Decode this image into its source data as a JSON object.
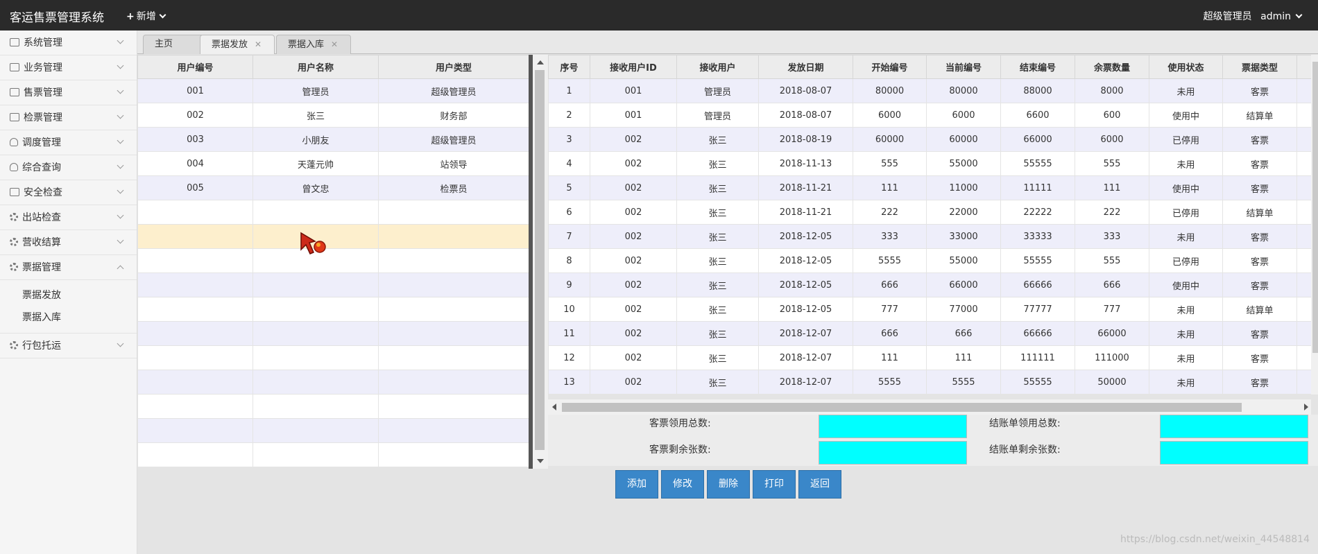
{
  "header": {
    "app_title": "客运售票管理系统",
    "new_menu": "新增",
    "user_role": "超级管理员",
    "user_name": "admin"
  },
  "sidebar": {
    "items": [
      {
        "label": "系统管理",
        "icon": "settings-icon"
      },
      {
        "label": "业务管理",
        "icon": "book-icon"
      },
      {
        "label": "售票管理",
        "icon": "calendar-icon"
      },
      {
        "label": "检票管理",
        "icon": "clipboard-icon"
      },
      {
        "label": "调度管理",
        "icon": "person-icon"
      },
      {
        "label": "综合查询",
        "icon": "user-icon"
      },
      {
        "label": "安全检查",
        "icon": "car-icon"
      },
      {
        "label": "出站检查",
        "icon": "gear-icon"
      },
      {
        "label": "营收结算",
        "icon": "gear-icon"
      },
      {
        "label": "票据管理",
        "icon": "gear-icon"
      },
      {
        "label": "行包托运",
        "icon": "gear-icon"
      }
    ],
    "subitems": [
      "票据发放",
      "票据入库"
    ]
  },
  "tabs": [
    {
      "label": "主页"
    },
    {
      "label": "票据发放"
    },
    {
      "label": "票据入库"
    }
  ],
  "left_table": {
    "headers": [
      "用户编号",
      "用户名称",
      "用户类型"
    ],
    "rows": [
      [
        "001",
        "管理员",
        "超级管理员"
      ],
      [
        "002",
        "张三",
        "财务部"
      ],
      [
        "003",
        "小朋友",
        "超级管理员"
      ],
      [
        "004",
        "天蓬元帅",
        "站领导"
      ],
      [
        "005",
        "曾文忠",
        "检票员"
      ]
    ]
  },
  "right_table": {
    "headers": [
      "序号",
      "接收用户ID",
      "接收用户",
      "发放日期",
      "开始编号",
      "当前编号",
      "结束编号",
      "余票数量",
      "使用状态",
      "票据类型"
    ],
    "rows": [
      [
        "1",
        "001",
        "管理员",
        "2018-08-07",
        "80000",
        "80000",
        "88000",
        "8000",
        "未用",
        "客票"
      ],
      [
        "2",
        "001",
        "管理员",
        "2018-08-07",
        "6000",
        "6000",
        "6600",
        "600",
        "使用中",
        "结算单"
      ],
      [
        "3",
        "002",
        "张三",
        "2018-08-19",
        "60000",
        "60000",
        "66000",
        "6000",
        "已停用",
        "客票"
      ],
      [
        "4",
        "002",
        "张三",
        "2018-11-13",
        "555",
        "55000",
        "55555",
        "555",
        "未用",
        "客票"
      ],
      [
        "5",
        "002",
        "张三",
        "2018-11-21",
        "111",
        "11000",
        "11111",
        "111",
        "使用中",
        "客票"
      ],
      [
        "6",
        "002",
        "张三",
        "2018-11-21",
        "222",
        "22000",
        "22222",
        "222",
        "已停用",
        "结算单"
      ],
      [
        "7",
        "002",
        "张三",
        "2018-12-05",
        "333",
        "33000",
        "33333",
        "333",
        "未用",
        "客票"
      ],
      [
        "8",
        "002",
        "张三",
        "2018-12-05",
        "5555",
        "55000",
        "55555",
        "555",
        "已停用",
        "客票"
      ],
      [
        "9",
        "002",
        "张三",
        "2018-12-05",
        "666",
        "66000",
        "66666",
        "666",
        "使用中",
        "客票"
      ],
      [
        "10",
        "002",
        "张三",
        "2018-12-05",
        "777",
        "77000",
        "77777",
        "777",
        "未用",
        "结算单"
      ],
      [
        "11",
        "002",
        "张三",
        "2018-12-07",
        "666",
        "666",
        "66666",
        "66000",
        "未用",
        "客票"
      ],
      [
        "12",
        "002",
        "张三",
        "2018-12-07",
        "111",
        "111",
        "111111",
        "111000",
        "未用",
        "客票"
      ],
      [
        "13",
        "002",
        "张三",
        "2018-12-07",
        "5555",
        "5555",
        "55555",
        "50000",
        "未用",
        "客票"
      ]
    ]
  },
  "summary": {
    "ticket_total_label": "客票领用总数:",
    "bill_total_label": "结账单领用总数:",
    "ticket_remain_label": "客票剩余张数:",
    "bill_remain_label": "结账单剩余张数:",
    "field_color": "#00ffff"
  },
  "buttons": {
    "add": "添加",
    "edit": "修改",
    "delete": "删除",
    "print": "打印",
    "back": "返回"
  },
  "watermark": "https://blog.csdn.net/weixin_44548814"
}
